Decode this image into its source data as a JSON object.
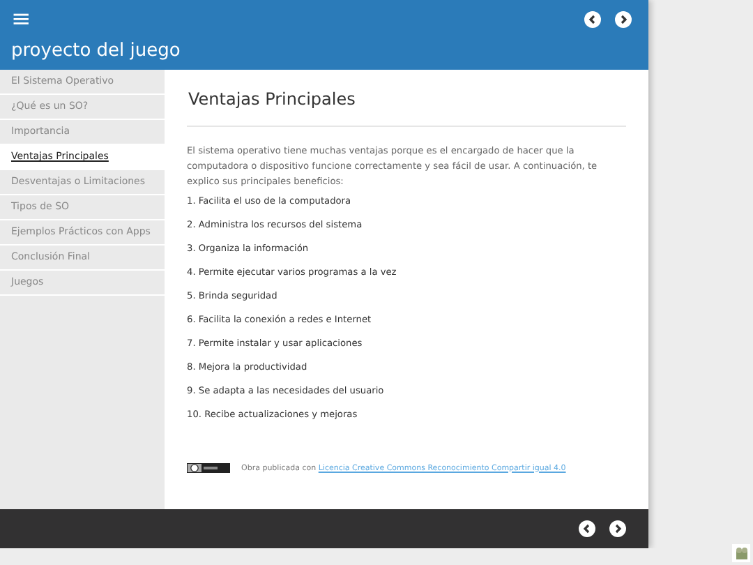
{
  "header": {
    "menu_icon": "≡",
    "title": "proyecto del juego"
  },
  "sidebar": {
    "items": [
      {
        "label": "El Sistema Operativo",
        "selected": false
      },
      {
        "label": "¿Qué es un SO?",
        "selected": false
      },
      {
        "label": "Importancia",
        "selected": false
      },
      {
        "label": "Ventajas Principales",
        "selected": true
      },
      {
        "label": "Desventajas o Limitaciones",
        "selected": false
      },
      {
        "label": "Tipos de SO",
        "selected": false
      },
      {
        "label": "Ejemplos Prácticos con Apps",
        "selected": false
      },
      {
        "label": "Conclusión Final",
        "selected": false
      },
      {
        "label": "Juegos",
        "selected": false
      }
    ]
  },
  "content": {
    "title": "Ventajas Principales",
    "intro": "El sistema operativo tiene muchas ventajas porque es el encargado de hacer que la computadora o dispositivo funcione correctamente y sea fácil de usar. A continuación, te explico sus principales beneficios:",
    "items": [
      "1. Facilita el uso de la computadora",
      "2. Administra los recursos del sistema",
      "3. Organiza la información",
      "4. Permite ejecutar varios programas a la vez",
      "5. Brinda seguridad",
      "6. Facilita la conexión a redes e Internet",
      "7. Permite instalar y usar aplicaciones",
      "8. Mejora la productividad",
      "9. Se adapta a las necesidades del usuario",
      "10. Recibe actualizaciones y mejoras"
    ],
    "license": {
      "text": "Obra publicada con",
      "link": "Licencia Creative Commons Reconocimiento Compartir igual 4.0"
    }
  }
}
